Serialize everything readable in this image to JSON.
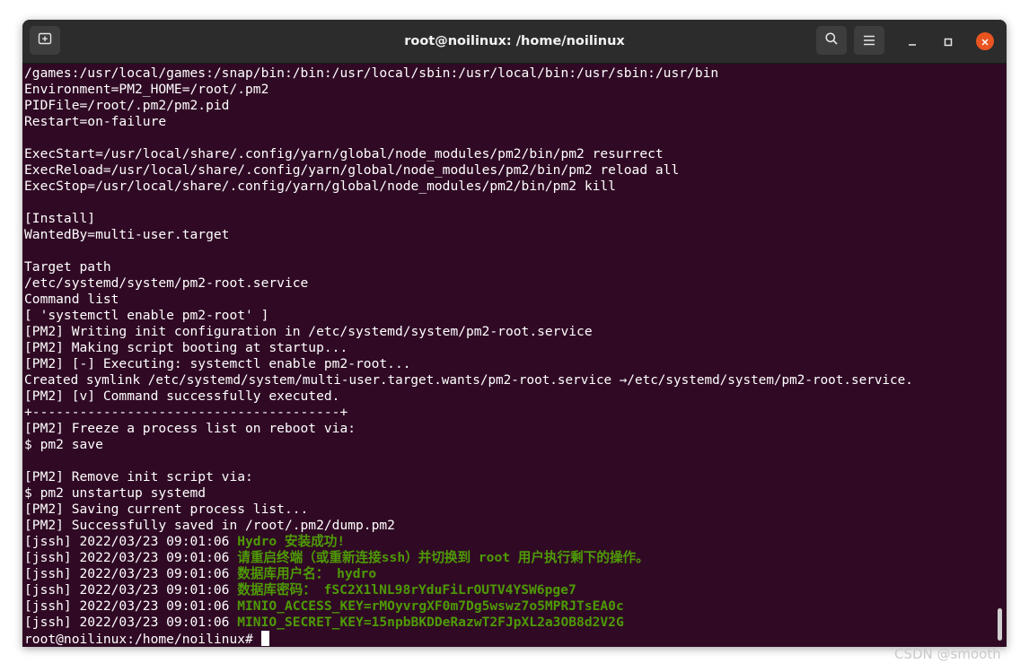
{
  "window": {
    "title": "root@noilinux: /home/noilinux"
  },
  "icons": {
    "new_tab": "new-tab-icon",
    "search": "search-icon",
    "menu": "hamburger-menu-icon",
    "minimize": "minimize-icon",
    "maximize": "maximize-icon",
    "close": "close-icon"
  },
  "colors": {
    "terminal_bg": "#300a24",
    "titlebar_bg": "#2c2c2c",
    "text": "#ffffff",
    "green": "#4e9a06",
    "close_button": "#e95420"
  },
  "terminal": {
    "lines": [
      "/games:/usr/local/games:/snap/bin:/bin:/usr/local/sbin:/usr/local/bin:/usr/sbin:/usr/bin",
      "Environment=PM2_HOME=/root/.pm2",
      "PIDFile=/root/.pm2/pm2.pid",
      "Restart=on-failure",
      "",
      "ExecStart=/usr/local/share/.config/yarn/global/node_modules/pm2/bin/pm2 resurrect",
      "ExecReload=/usr/local/share/.config/yarn/global/node_modules/pm2/bin/pm2 reload all",
      "ExecStop=/usr/local/share/.config/yarn/global/node_modules/pm2/bin/pm2 kill",
      "",
      "[Install]",
      "WantedBy=multi-user.target",
      "",
      "Target path",
      "/etc/systemd/system/pm2-root.service",
      "Command list",
      "[ 'systemctl enable pm2-root' ]",
      "[PM2] Writing init configuration in /etc/systemd/system/pm2-root.service",
      "[PM2] Making script booting at startup...",
      "[PM2] [-] Executing: systemctl enable pm2-root...",
      "Created symlink /etc/systemd/system/multi-user.target.wants/pm2-root.service →/etc/systemd/system/pm2-root.service.",
      "[PM2] [v] Command successfully executed.",
      "+---------------------------------------+",
      "[PM2] Freeze a process list on reboot via:",
      "$ pm2 save",
      "",
      "[PM2] Remove init script via:",
      "$ pm2 unstartup systemd",
      "[PM2] Saving current process list...",
      "[PM2] Successfully saved in /root/.pm2/dump.pm2"
    ],
    "jssh_lines": [
      {
        "prefix": "[jssh] 2022/03/23 09:01:06 ",
        "message": "Hydro 安装成功!"
      },
      {
        "prefix": "[jssh] 2022/03/23 09:01:06 ",
        "message": "请重启终端（或重新连接ssh）并切换到 root 用户执行剩下的操作。"
      },
      {
        "prefix": "[jssh] 2022/03/23 09:01:06 ",
        "message": "数据库用户名： hydro"
      },
      {
        "prefix": "[jssh] 2022/03/23 09:01:06 ",
        "message": "数据库密码： fSC2X1lNL98rYduFiLrOUTV4YSW6pge7"
      },
      {
        "prefix": "[jssh] 2022/03/23 09:01:06 ",
        "message": "MINIO_ACCESS_KEY=rMOyvrgXF0m7Dg5wswz7o5MPRJTsEA0c"
      },
      {
        "prefix": "[jssh] 2022/03/23 09:01:06 ",
        "message": "MINIO_SECRET_KEY=15npbBKDDeRazwT2FJpXL2a3OB8d2V2G"
      }
    ],
    "prompt": "root@noilinux:/home/noilinux# "
  },
  "watermark": "CSDN @smooth"
}
